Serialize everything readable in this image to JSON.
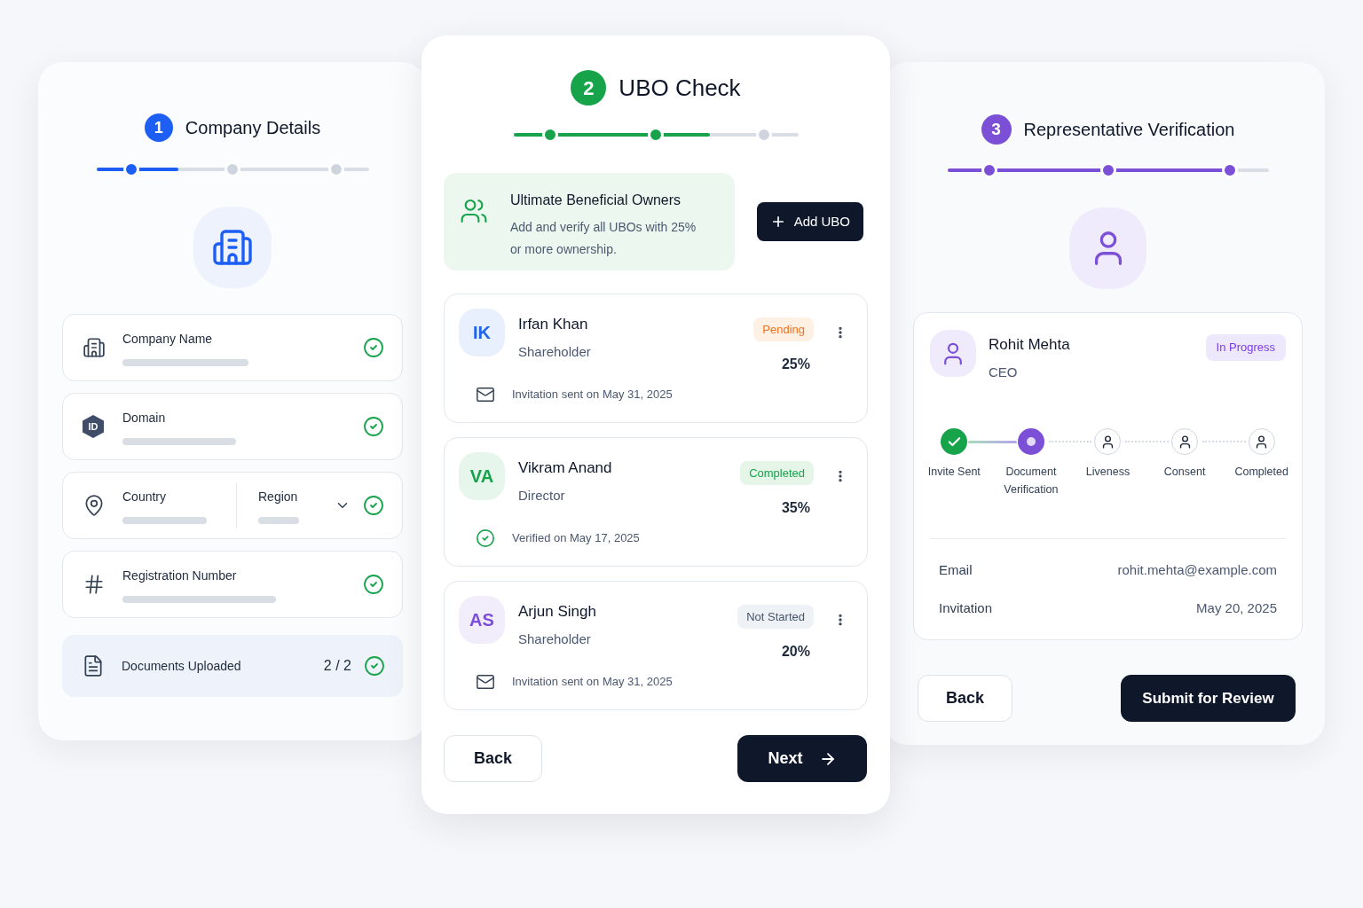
{
  "company_details": {
    "number": "1",
    "title": "Company Details",
    "progress": {
      "level": 0.3
    },
    "fields": [
      {
        "kind": "single",
        "label": "Company Name",
        "verified": true
      },
      {
        "kind": "single",
        "icon_text": "ID",
        "label": "Domain",
        "verified": true
      },
      {
        "kind": "pair",
        "label": "Country",
        "second_label": "Region",
        "verified": true
      },
      {
        "kind": "single",
        "label": "Registration Number",
        "verified": true
      }
    ],
    "documents": {
      "label": "Documents Uploaded",
      "count": "2 / 2",
      "verified": true
    }
  },
  "ubo_check": {
    "number": "2",
    "title": "UBO Check",
    "progress": {
      "level": 0.69
    },
    "intro": {
      "title": "Ultimate Beneficial Owners",
      "text": "Add and verify all UBOs with 25% or more ownership."
    },
    "add_button": "Add UBO",
    "owners": [
      {
        "initials": "IK",
        "color": "#1d63ed",
        "name": "Irfan Khan",
        "role": "Shareholder",
        "status": {
          "kind": "pending",
          "label": "Pending"
        },
        "share": "25%",
        "note": {
          "kind": "invitation",
          "text": "Invitation sent on May 31, 2025"
        }
      },
      {
        "initials": "VA",
        "color": "#16a34a",
        "name": "Vikram Anand",
        "role": "Director",
        "status": {
          "kind": "completed",
          "label": "Completed"
        },
        "share": "35%",
        "note": {
          "kind": "verified",
          "text": "Verified on May 17, 2025"
        }
      },
      {
        "initials": "AS",
        "color": "#7c4ddb",
        "name": "Arjun Singh",
        "role": "Shareholder",
        "status": {
          "kind": "not_started",
          "label": "Not Started"
        },
        "share": "20%",
        "note": {
          "kind": "invitation",
          "text": "Invitation sent on May 31, 2025"
        }
      }
    ],
    "back_button": "Back",
    "next_button": "Next"
  },
  "representative_verification": {
    "number": "3",
    "title": "Representative Verification",
    "progress": {
      "level": 0.9
    },
    "representative": {
      "name": "Rohit Mehta",
      "role": "CEO",
      "status": {
        "kind": "in_progress",
        "label": "In Progress"
      }
    },
    "stages": [
      {
        "label": "Invite Sent",
        "kind": "done"
      },
      {
        "label": "Document Verification",
        "kind": "current"
      },
      {
        "label": "Liveness",
        "kind": "pending"
      },
      {
        "label": "Consent",
        "kind": "pending"
      },
      {
        "label": "Completed",
        "kind": "pending"
      }
    ],
    "details": [
      {
        "label": "Email",
        "value": "rohit.mehta@example.com"
      },
      {
        "label": "Invitation",
        "value": "May 20, 2025"
      }
    ],
    "back_button": "Back",
    "submit_button": "Submit for Review"
  }
}
